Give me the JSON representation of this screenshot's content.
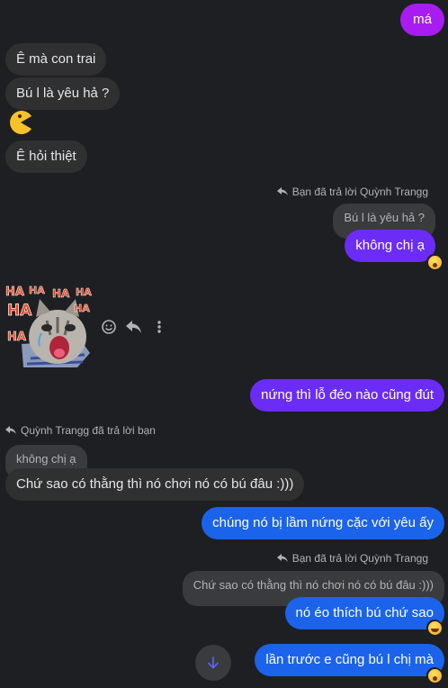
{
  "messages": {
    "m1": "má",
    "m2": "Ê mà con trai",
    "m3": "Bú l là yêu hả ?",
    "m4": "Ê hỏi thiệt",
    "reply1_note": "Bạn đã trả lời Quỳnh Trangg",
    "reply1_quoted": "Bú l là yêu hả ?",
    "m5": "không chị ạ",
    "m6": "nứng thì lỗ đéo nào cũng đút",
    "reply2_note": "Quỳnh Trangg đã trả lời bạn",
    "reply2_quoted": "không chị ạ",
    "m7": "Chứ sao có thằng thì nó chơi nó có bú đâu :)))",
    "m8": "chúng nó bị lầm nứng cặc với yêu ấy",
    "reply3_note": "Bạn đã trả lời Quỳnh Trangg",
    "reply3_quoted": "Chứ sao có thằng thì nó chơi nó có bú đâu :)))",
    "m9": "nó éo thích bú chứ sao",
    "m10": "lần trước e cũng bú l chị mà"
  },
  "sticker": {
    "text": "HA HA HA HA HA HA HA"
  },
  "colors": {
    "background": "#1e1f22",
    "incoming": "#303030",
    "outgoing_purple": "#6b2cf5",
    "outgoing_blue": "#1b63ea",
    "outgoing_magenta": "#a81cf2"
  },
  "icons": [
    "pacman-emoji-icon",
    "reply-arrow-icon",
    "emoji-react-icon",
    "reply-icon",
    "more-options-icon",
    "reaction-wow-icon",
    "reaction-laugh-icon",
    "scroll-down-arrow-icon"
  ]
}
